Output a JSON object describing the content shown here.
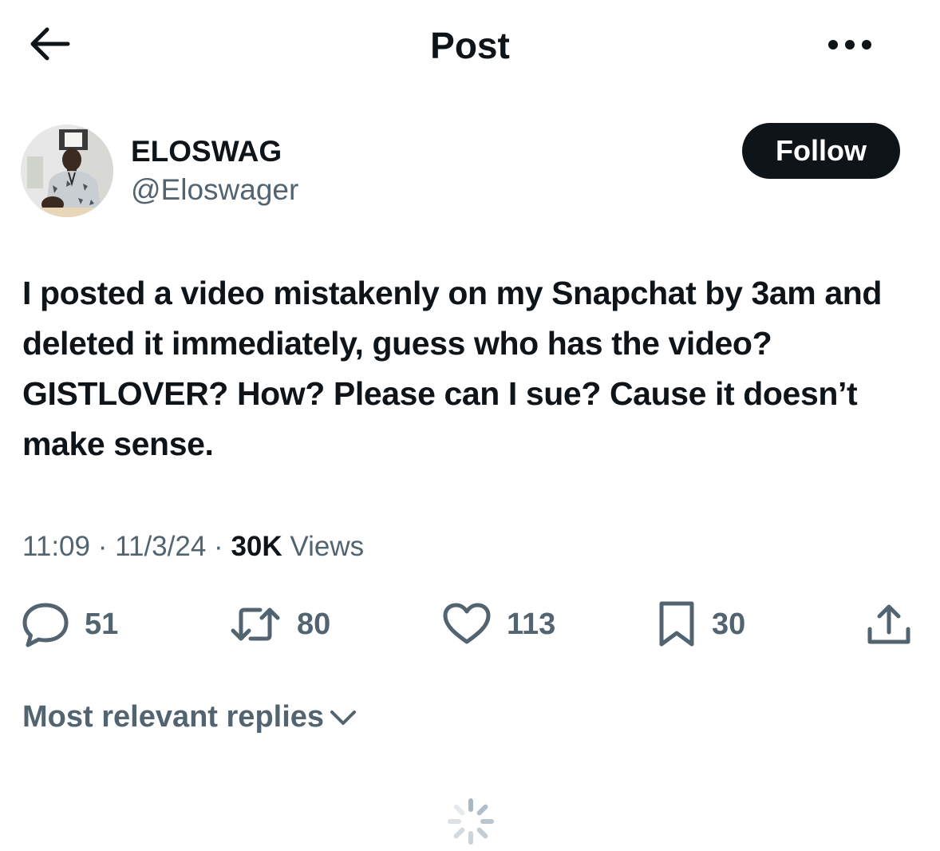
{
  "header": {
    "title": "Post",
    "back_icon": "arrow-left-icon",
    "more_icon": "more-horizontal-icon"
  },
  "author": {
    "display_name": "ELOSWAG",
    "handle": "@Eloswager",
    "follow_label": "Follow"
  },
  "post": {
    "text": "I posted a video mistakenly on my Snapchat by 3am and deleted it immediately, guess who has the video? GISTLOVER? How? Please can I sue? Cause it doesn’t make sense.",
    "time": "11:09",
    "date": "11/3/24",
    "views_count": "30K",
    "views_label": "Views",
    "separator": "·"
  },
  "actions": {
    "replies": {
      "icon": "reply-icon",
      "count": "51"
    },
    "reposts": {
      "icon": "repost-icon",
      "count": "80"
    },
    "likes": {
      "icon": "heart-icon",
      "count": "113"
    },
    "bookmarks": {
      "icon": "bookmark-icon",
      "count": "30"
    },
    "share": {
      "icon": "share-icon"
    }
  },
  "replies_sort": {
    "label": "Most relevant replies",
    "icon": "chevron-down-icon"
  },
  "colors": {
    "text": "#0f1419",
    "secondary": "#536471",
    "follow_bg": "#0f1419",
    "follow_text": "#ffffff",
    "spinner": "#aab8c2"
  }
}
